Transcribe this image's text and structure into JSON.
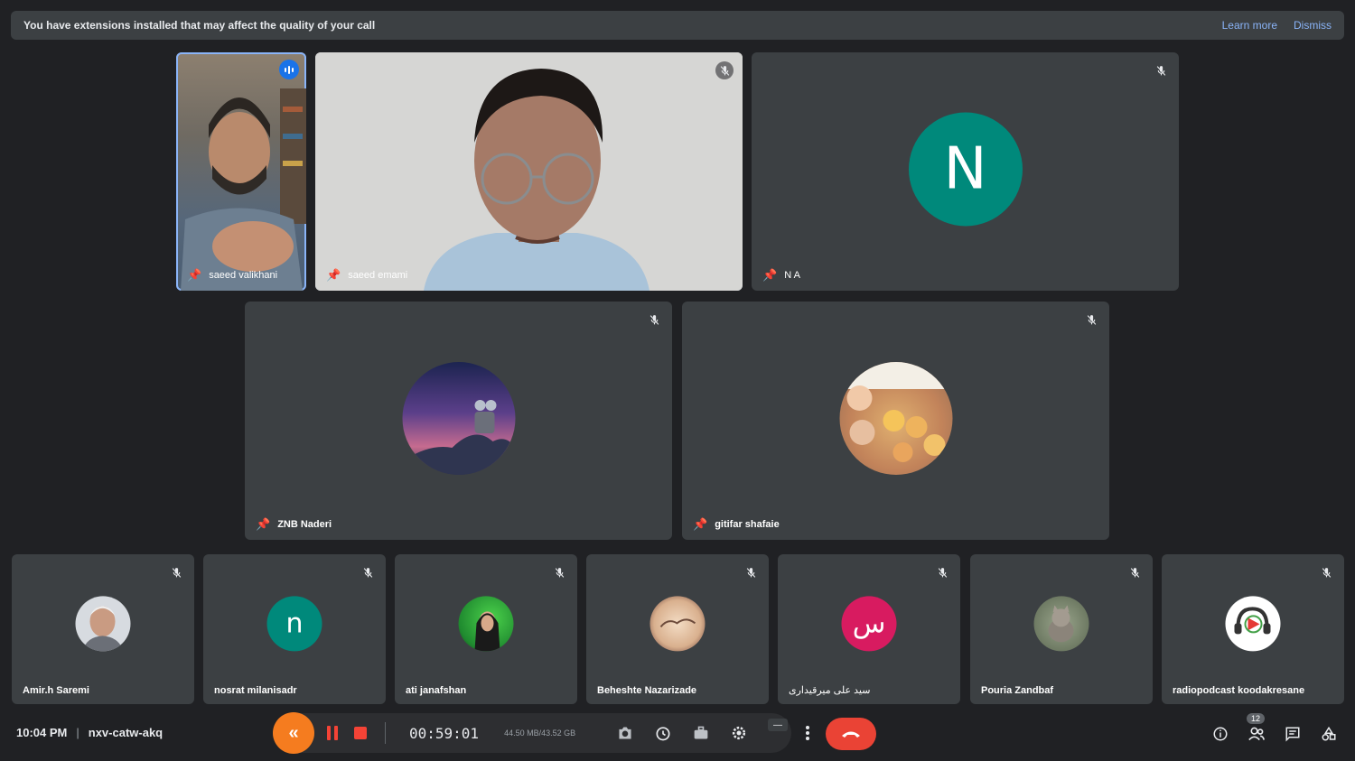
{
  "banner": {
    "message": "You have extensions installed that may affect the quality of your call",
    "learn_more": "Learn more",
    "dismiss": "Dismiss"
  },
  "participants": {
    "p1": {
      "name": "saeed valikhani"
    },
    "p2": {
      "name": "saeed emami"
    },
    "p3": {
      "name": "N A",
      "initial": "N",
      "color": "#00897b"
    },
    "p4": {
      "name": "ZNB Naderi"
    },
    "p5": {
      "name": "gitifar shafaie"
    },
    "p6": {
      "name": "Amir.h Saremi"
    },
    "p7": {
      "name": "nosrat milanisadr",
      "initial": "n",
      "color": "#00897b"
    },
    "p8": {
      "name": "ati janafshan"
    },
    "p9": {
      "name": "Beheshte Nazarizade"
    },
    "p10": {
      "name": "سید علی میرقیداری",
      "initial": "س",
      "color": "#d81b60"
    },
    "p11": {
      "name": "Pouria Zandbaf"
    },
    "p12": {
      "name": "radiopodcast koodakresane"
    }
  },
  "footer": {
    "time": "10:04 PM",
    "meeting_code": "nxv-catw-akq",
    "participant_count": "12"
  },
  "recorder": {
    "elapsed": "00:59:01",
    "size": "44.50 MB/43.52 GB"
  },
  "colors": {
    "background": "#202124",
    "tile": "#3c4043",
    "accent": "#8ab4f8",
    "hangup": "#ea4335",
    "recorder_accent": "#f57c1f"
  }
}
